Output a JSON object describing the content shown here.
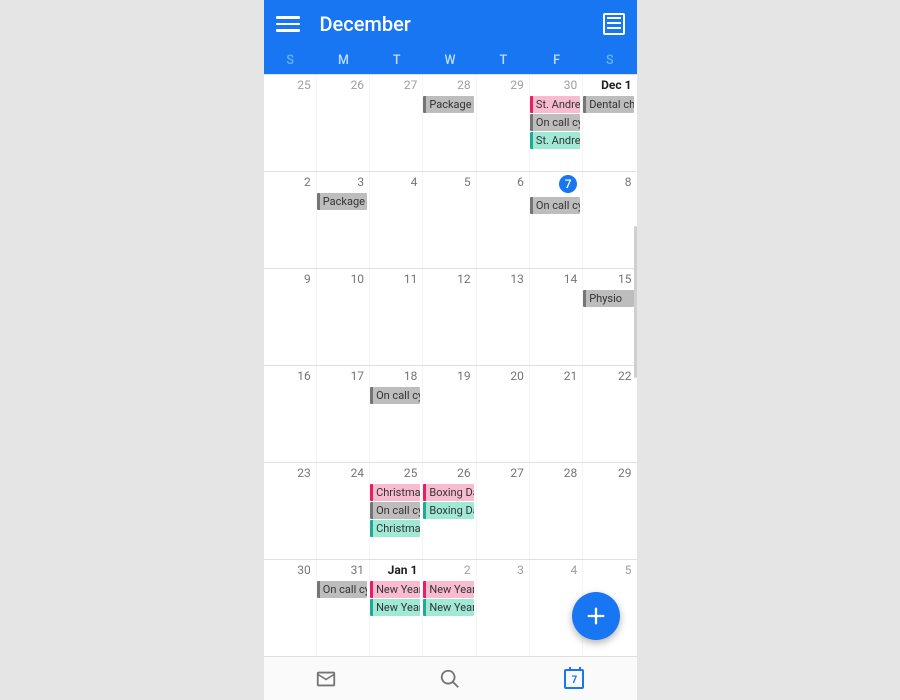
{
  "header": {
    "title": "December"
  },
  "dow": [
    "S",
    "M",
    "T",
    "W",
    "T",
    "F",
    "S"
  ],
  "weeks": [
    {
      "days": [
        {
          "label": "25",
          "inMonth": false,
          "chips": []
        },
        {
          "label": "26",
          "inMonth": false,
          "chips": []
        },
        {
          "label": "27",
          "inMonth": false,
          "chips": []
        },
        {
          "label": "28",
          "inMonth": false,
          "chips": [
            {
              "text": "Package f",
              "color": "grey"
            }
          ]
        },
        {
          "label": "29",
          "inMonth": false,
          "chips": []
        },
        {
          "label": "30",
          "inMonth": false,
          "chips": [
            {
              "text": "St. Andrew",
              "color": "pink"
            },
            {
              "text": "On call cy",
              "color": "grey"
            },
            {
              "text": "St. Andrew",
              "color": "teal"
            }
          ]
        },
        {
          "label": "Dec 1",
          "inMonth": true,
          "bold": true,
          "chips": [
            {
              "text": "Dental che",
              "color": "grey"
            }
          ]
        }
      ]
    },
    {
      "days": [
        {
          "label": "2",
          "inMonth": true,
          "chips": []
        },
        {
          "label": "3",
          "inMonth": true,
          "chips": [
            {
              "text": "Package f",
              "color": "grey"
            }
          ]
        },
        {
          "label": "4",
          "inMonth": true,
          "chips": []
        },
        {
          "label": "5",
          "inMonth": true,
          "chips": []
        },
        {
          "label": "6",
          "inMonth": true,
          "chips": []
        },
        {
          "label": "7",
          "inMonth": true,
          "today": true,
          "chips": [
            {
              "text": "On call cy",
              "color": "grey"
            }
          ]
        },
        {
          "label": "8",
          "inMonth": true,
          "chips": []
        }
      ]
    },
    {
      "days": [
        {
          "label": "9",
          "inMonth": true,
          "chips": []
        },
        {
          "label": "10",
          "inMonth": true,
          "chips": []
        },
        {
          "label": "11",
          "inMonth": true,
          "chips": []
        },
        {
          "label": "12",
          "inMonth": true,
          "chips": []
        },
        {
          "label": "13",
          "inMonth": true,
          "chips": []
        },
        {
          "label": "14",
          "inMonth": true,
          "chips": []
        },
        {
          "label": "15",
          "inMonth": true,
          "chips": [
            {
              "text": "Physio",
              "color": "grey"
            }
          ]
        }
      ]
    },
    {
      "days": [
        {
          "label": "16",
          "inMonth": true,
          "chips": []
        },
        {
          "label": "17",
          "inMonth": true,
          "chips": []
        },
        {
          "label": "18",
          "inMonth": true,
          "chips": [
            {
              "text": "On call cy",
              "color": "grey"
            }
          ]
        },
        {
          "label": "19",
          "inMonth": true,
          "chips": []
        },
        {
          "label": "20",
          "inMonth": true,
          "chips": []
        },
        {
          "label": "21",
          "inMonth": true,
          "chips": []
        },
        {
          "label": "22",
          "inMonth": true,
          "chips": []
        }
      ]
    },
    {
      "days": [
        {
          "label": "23",
          "inMonth": true,
          "chips": []
        },
        {
          "label": "24",
          "inMonth": true,
          "chips": []
        },
        {
          "label": "25",
          "inMonth": true,
          "chips": [
            {
              "text": "Christmas",
              "color": "pink"
            },
            {
              "text": "On call cy",
              "color": "grey"
            },
            {
              "text": "Christmas",
              "color": "teal"
            }
          ]
        },
        {
          "label": "26",
          "inMonth": true,
          "chips": [
            {
              "text": "Boxing Da",
              "color": "pink"
            },
            {
              "text": "Boxing Da",
              "color": "teal"
            }
          ]
        },
        {
          "label": "27",
          "inMonth": true,
          "chips": []
        },
        {
          "label": "28",
          "inMonth": true,
          "chips": []
        },
        {
          "label": "29",
          "inMonth": true,
          "chips": []
        }
      ]
    },
    {
      "days": [
        {
          "label": "30",
          "inMonth": true,
          "chips": []
        },
        {
          "label": "31",
          "inMonth": true,
          "chips": [
            {
              "text": "On call cy",
              "color": "grey"
            }
          ]
        },
        {
          "label": "Jan 1",
          "inMonth": false,
          "bold": true,
          "chips": [
            {
              "text": "New Year",
              "color": "pink"
            },
            {
              "text": "New Year",
              "color": "teal"
            }
          ]
        },
        {
          "label": "2",
          "inMonth": false,
          "chips": [
            {
              "text": "New Year",
              "color": "pink"
            },
            {
              "text": "New Year",
              "color": "teal"
            }
          ]
        },
        {
          "label": "3",
          "inMonth": false,
          "chips": []
        },
        {
          "label": "4",
          "inMonth": false,
          "chips": []
        },
        {
          "label": "5",
          "inMonth": false,
          "chips": []
        }
      ]
    }
  ],
  "bottom_nav": {
    "calendar_date": "7"
  }
}
